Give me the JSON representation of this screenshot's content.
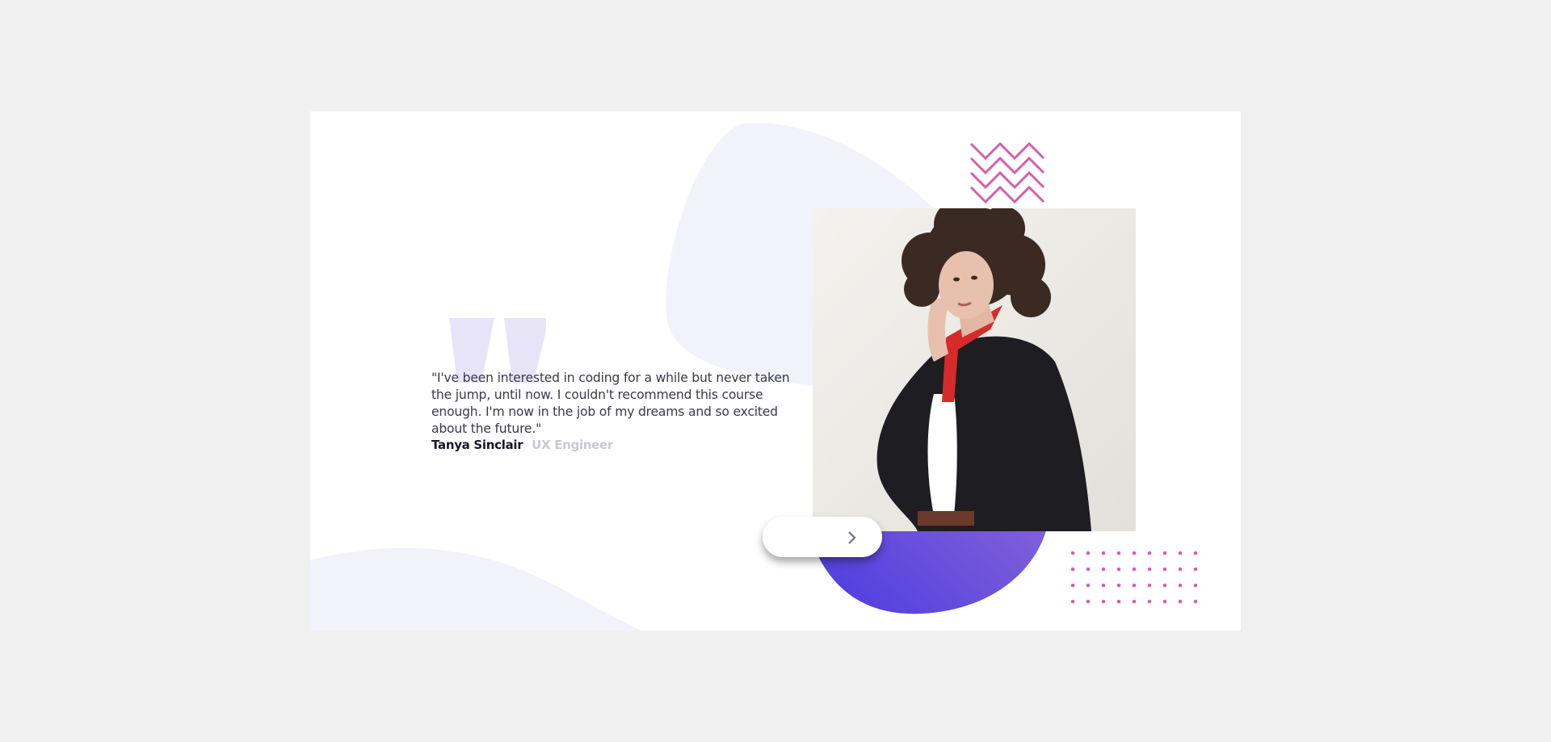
{
  "testimonial": {
    "quote": "\"I've been interested in coding for a while but never taken the jump, until now. I couldn't recommend this course enough. I'm now in the job of my dreams and so excited about the future.\"",
    "author_name": "Tanya Sinclair",
    "author_role": "UX Engineer"
  },
  "navigation": {
    "prev_icon": "chevron-left-icon",
    "next_icon": "chevron-right-icon"
  },
  "colors": {
    "page_background": "#f0f0f0",
    "card_background": "#ffffff",
    "light_blob": "#f2f2fb",
    "purple_gradient_start": "#4b3adf",
    "purple_gradient_end": "#9a73d6",
    "accent_pink": "#d560a8",
    "quote_mark": "#e6e1f7",
    "text_dark": "#18182a",
    "text_role": "#c9c9d6"
  }
}
